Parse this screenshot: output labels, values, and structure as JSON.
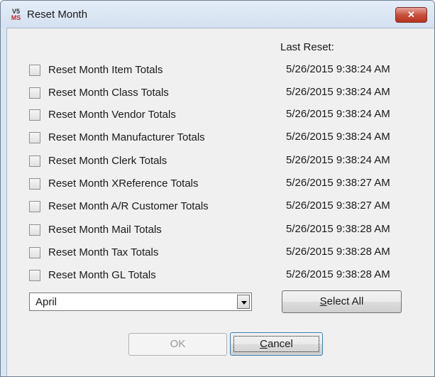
{
  "window": {
    "title": "Reset Month",
    "app_icon_top": "V5",
    "app_icon_bottom": "MS",
    "close_glyph": "✕"
  },
  "header": {
    "last_reset": "Last Reset:"
  },
  "rows": [
    {
      "label": "Reset Month Item Totals",
      "date": "5/26/2015 9:38:24 AM",
      "checked": false
    },
    {
      "label": "Reset Month Class Totals",
      "date": "5/26/2015 9:38:24 AM",
      "checked": false
    },
    {
      "label": "Reset Month Vendor Totals",
      "date": "5/26/2015 9:38:24 AM",
      "checked": false
    },
    {
      "label": "Reset Month Manufacturer Totals",
      "date": "5/26/2015 9:38:24 AM",
      "checked": false
    },
    {
      "label": "Reset Month Clerk Totals",
      "date": "5/26/2015 9:38:24 AM",
      "checked": false
    },
    {
      "label": "Reset Month XReference Totals",
      "date": "5/26/2015 9:38:27 AM",
      "checked": false
    },
    {
      "label": "Reset Month A/R Customer Totals",
      "date": "5/26/2015 9:38:27 AM",
      "checked": false
    },
    {
      "label": "Reset Month Mail Totals",
      "date": "5/26/2015 9:38:28 AM",
      "checked": false
    },
    {
      "label": "Reset Month Tax Totals",
      "date": "5/26/2015 9:38:28 AM",
      "checked": false
    },
    {
      "label": "Reset Month GL Totals",
      "date": "5/26/2015 9:38:28 AM",
      "checked": false
    }
  ],
  "month_select": {
    "value": "April"
  },
  "buttons": {
    "select_all_accel": "S",
    "select_all_rest": "elect All",
    "ok": "OK",
    "cancel_accel": "C",
    "cancel_rest": "ancel"
  },
  "colors": {
    "close_button": "#c9503e",
    "title_bar": "#dbe6f3",
    "client_bg": "#f0f0f0"
  },
  "icons": {
    "checkbox": "checkbox-unchecked",
    "dropdown": "chevron-down-icon",
    "close": "close-icon"
  }
}
